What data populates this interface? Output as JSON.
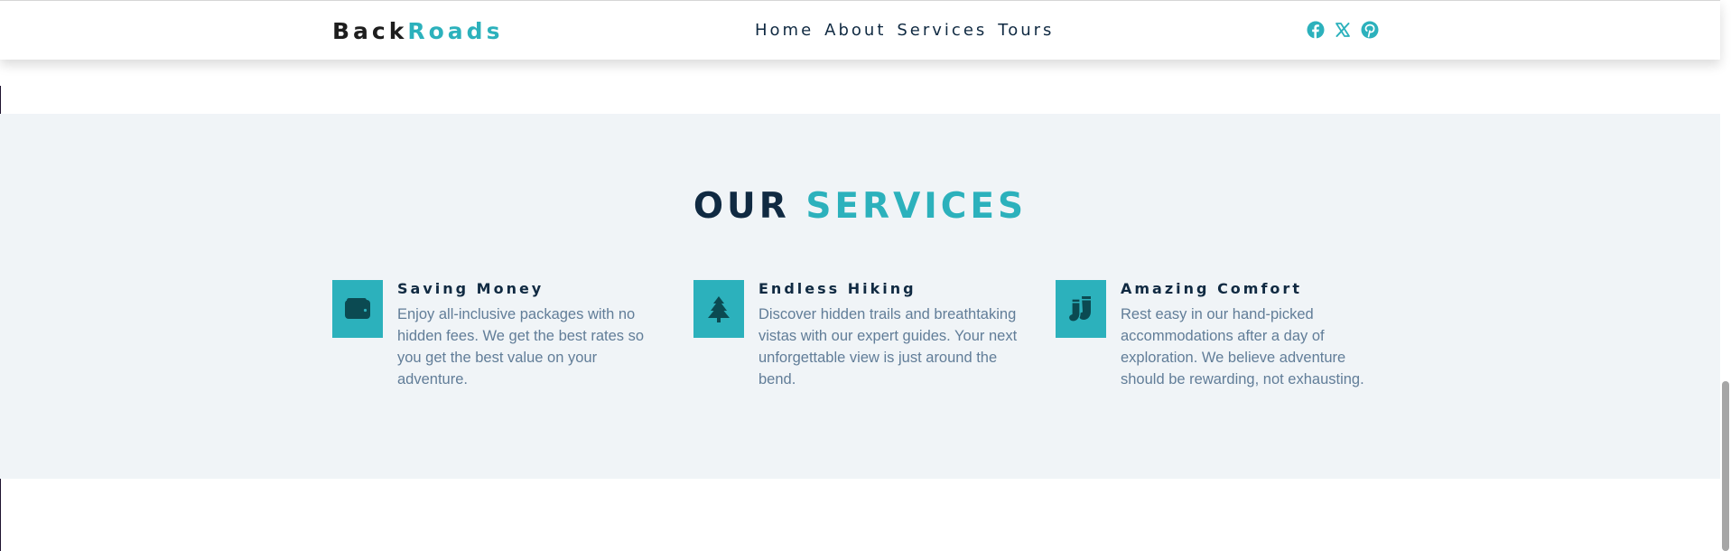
{
  "nav": {
    "logo_part1": "Back",
    "logo_part2": "Roads",
    "links": [
      "Home",
      "About",
      "Services",
      "Tours"
    ],
    "social_icons": [
      "facebook-icon",
      "x-twitter-icon",
      "pinterest-icon"
    ]
  },
  "services": {
    "title_part1": "OUR",
    "title_part2": "SERVICES",
    "items": [
      {
        "icon": "wallet-icon",
        "title": "Saving Money",
        "text": "Enjoy all-inclusive packages with no hidden fees. We get the best rates so you get the best value on your adventure."
      },
      {
        "icon": "tree-icon",
        "title": "Endless Hiking",
        "text": "Discover hidden trails and breathtaking vistas with our expert guides. Your next unforgettable view is just around the bend."
      },
      {
        "icon": "socks-icon",
        "title": "Amazing Comfort",
        "text": "Rest easy in our hand-picked accommodations after a day of exploration. We believe adventure should be rewarding, not exhausting."
      }
    ]
  },
  "colors": {
    "primary": "#2cb1bc",
    "heading": "#102a42",
    "body_text": "#617d98",
    "section_bg": "#f0f4f7",
    "icon_fill": "#0b4a52"
  }
}
